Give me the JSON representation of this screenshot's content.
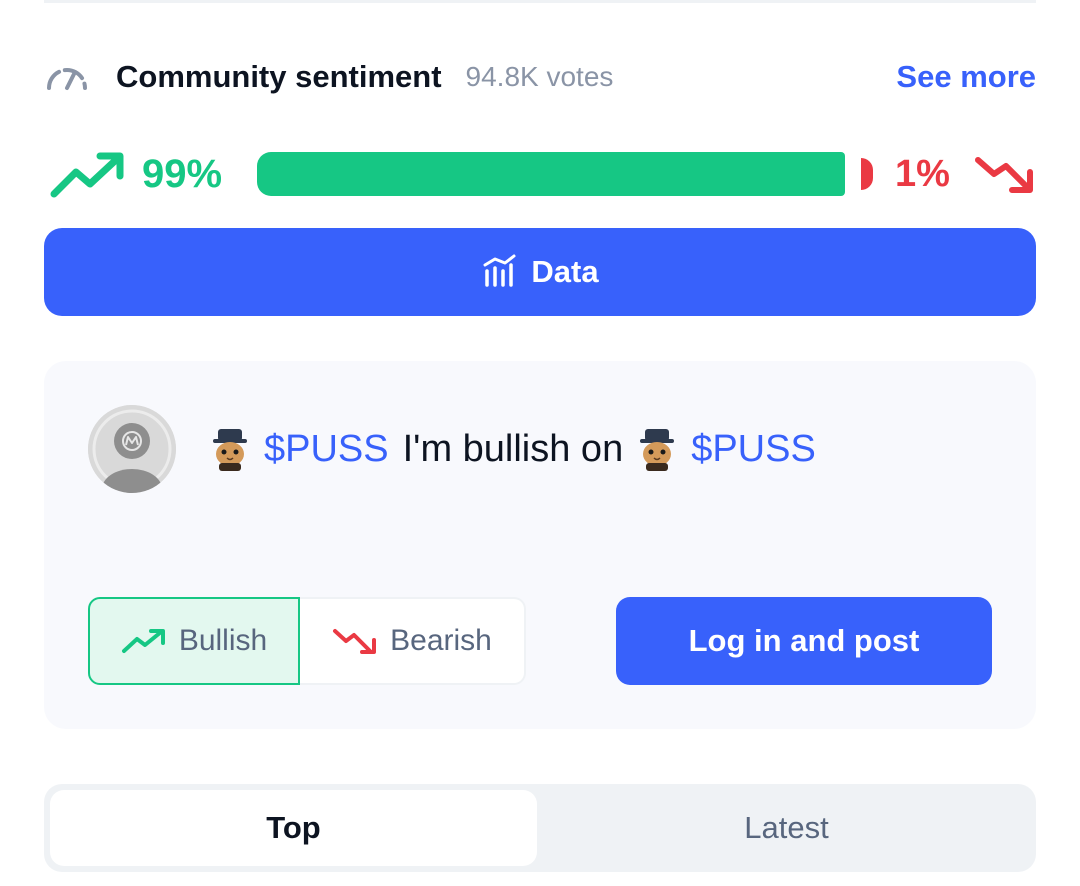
{
  "sentiment": {
    "title": "Community sentiment",
    "votes": "94.8K votes",
    "see_more": "See more",
    "bullish_pct_label": "99%",
    "bearish_pct_label": "1%",
    "bullish_fraction": 0.99,
    "colors": {
      "bull": "#16c784",
      "bear": "#ea3943",
      "accent": "#3861fb"
    }
  },
  "data_button": {
    "label": "Data",
    "icon": "bar-chart-icon"
  },
  "post": {
    "ticker_1": "$PUSS",
    "middle_text": "I'm bullish on",
    "ticker_2": "$PUSS",
    "toggle": {
      "bullish": "Bullish",
      "bearish": "Bearish",
      "selected": "Bullish"
    },
    "login_button": "Log in and post"
  },
  "tabs": [
    {
      "label": "Top",
      "active": true
    },
    {
      "label": "Latest",
      "active": false
    }
  ]
}
